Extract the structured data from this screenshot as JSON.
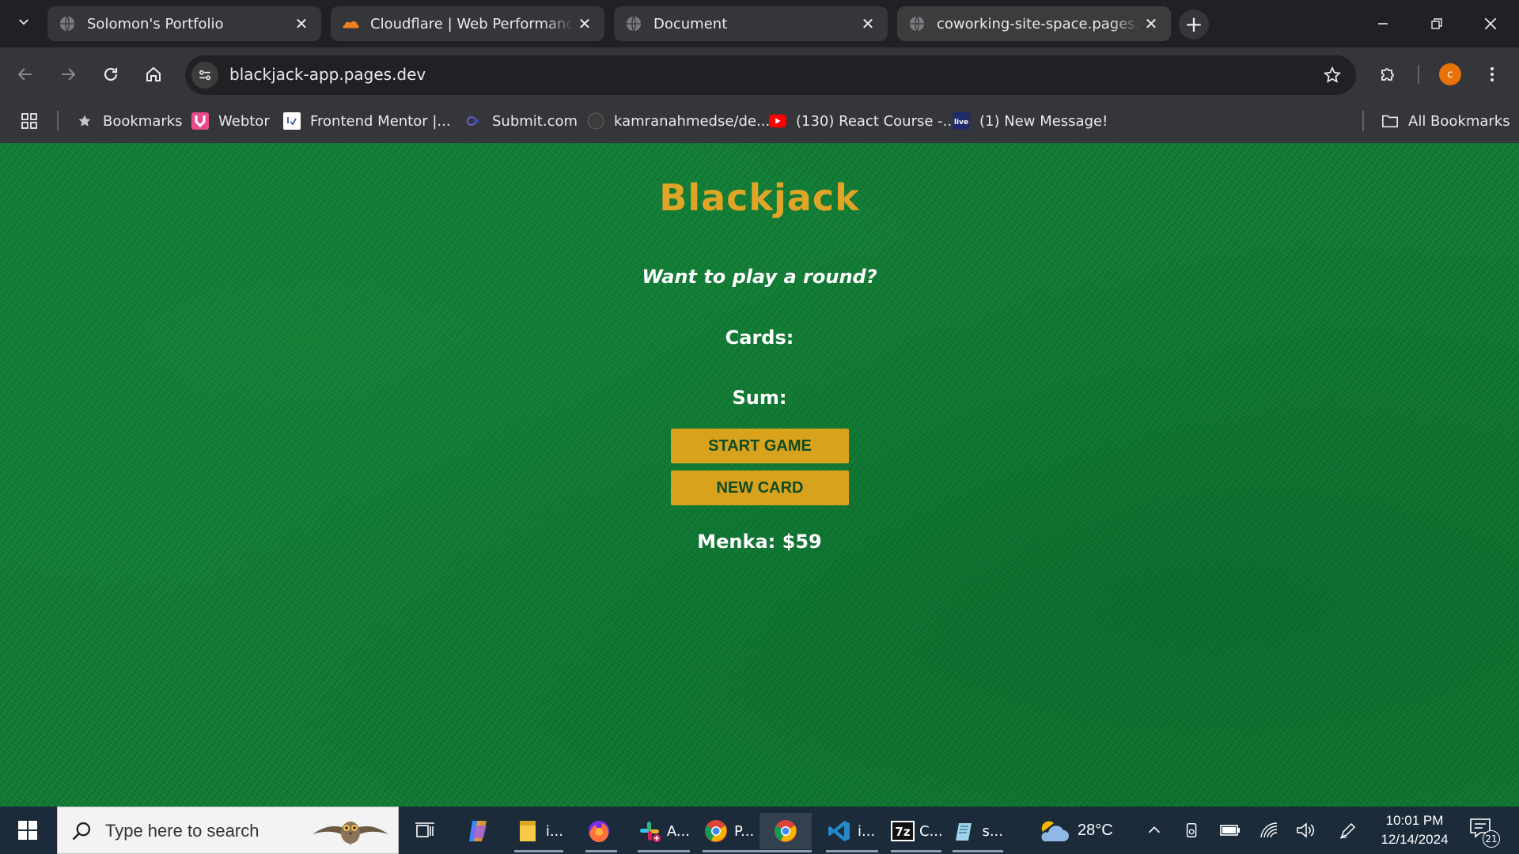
{
  "browser": {
    "tabs": [
      {
        "title": "Solomon's Portfolio",
        "icon": "globe-icon"
      },
      {
        "title": "Cloudflare | Web Performance & Security",
        "icon": "cloudflare-icon"
      },
      {
        "title": "Document",
        "icon": "globe-icon"
      },
      {
        "title": "coworking-site-space.pages.dev",
        "icon": "globe-icon"
      }
    ],
    "active_tab_index": 3,
    "address": "blackjack-app.pages.dev",
    "profile_initial": "c",
    "profile_color": "#e8710a",
    "bookmarks": [
      {
        "label": "Bookmarks",
        "icon": "star-icon"
      },
      {
        "label": "Webtor",
        "icon": "webtor-icon"
      },
      {
        "label": "Frontend Mentor |...",
        "icon": "frontend-mentor-icon"
      },
      {
        "label": "Submit.com",
        "icon": "submit-icon"
      },
      {
        "label": "kamranahmedse/de...",
        "icon": "github-icon"
      },
      {
        "label": "(130) React Course -...",
        "icon": "youtube-icon"
      },
      {
        "label": "(1) New Message!",
        "icon": "live-icon"
      }
    ],
    "all_bookmarks": "All Bookmarks"
  },
  "page": {
    "title": "Blackjack",
    "message": "Want to play a round?",
    "cards_label": "Cards:",
    "sum_label": "Sum:",
    "start_button": "START GAME",
    "new_card_button": "NEW CARD",
    "player": "Menka: $59",
    "accent_color": "#e0a526",
    "button_color": "#d9a21c",
    "felt_color": "#0f7a33"
  },
  "taskbar": {
    "search_placeholder": "Type here to search",
    "apps": [
      {
        "label": "",
        "icon": "task-view-icon"
      },
      {
        "label": "",
        "icon": "copilot-icon"
      },
      {
        "label": "i...",
        "icon": "file-explorer-icon"
      },
      {
        "label": "",
        "icon": "firefox-icon"
      },
      {
        "label": "A...",
        "icon": "slack-icon"
      },
      {
        "label": "P...",
        "icon": "chrome-icon"
      },
      {
        "label": "",
        "icon": "chrome-icon"
      },
      {
        "label": "i...",
        "icon": "vscode-icon"
      },
      {
        "label": "C...",
        "icon": "7zip-icon"
      },
      {
        "label": "s...",
        "icon": "notepad-icon"
      }
    ],
    "weather": "28°C",
    "time": "10:01 PM",
    "date": "12/14/2024",
    "notification_count": "21"
  }
}
